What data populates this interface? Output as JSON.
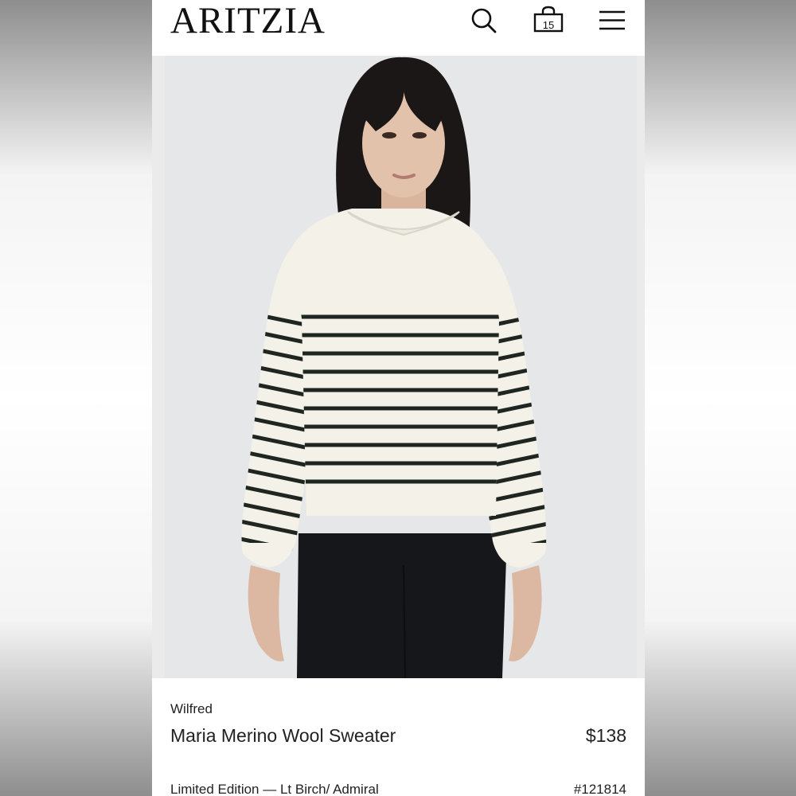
{
  "header": {
    "logo": "ARITZIA",
    "search_icon": "search-icon",
    "bag_icon": "shopping-bag-icon",
    "bag_count": "15",
    "menu_icon": "hamburger-menu-icon"
  },
  "product_image": {
    "alt": "Maria Merino Wool Sweater"
  },
  "product": {
    "brand": "Wilfred",
    "name": "Maria Merino Wool Sweater",
    "price": "$138",
    "variant": "Limited Edition — Lt Birch/ Admiral",
    "sku": "#121814"
  },
  "colors": {
    "background_outer": "#8e8e8e",
    "image_bg": "#e6e7e9",
    "sweater": "#f3f1e8",
    "stripe": "#1f2622",
    "pants": "#16171a",
    "hair": "#1a1716",
    "skin": "#e3c2ac"
  }
}
